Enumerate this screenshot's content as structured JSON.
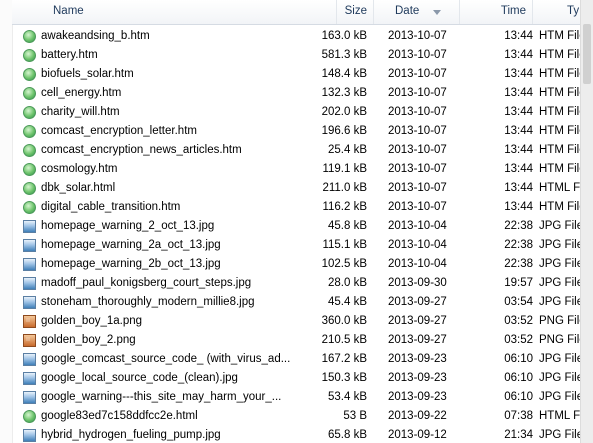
{
  "columns": {
    "name": "Name",
    "size": "Size",
    "date": "Date",
    "time": "Time",
    "type": "Ty"
  },
  "files": [
    {
      "name": "awakeandsing_b.htm",
      "size": "163.0 kB",
      "date": "2013-10-07",
      "time": "13:44",
      "type": "HTM File",
      "icon": "htm-file-icon"
    },
    {
      "name": "battery.htm",
      "size": "581.3 kB",
      "date": "2013-10-07",
      "time": "13:44",
      "type": "HTM File",
      "icon": "htm-file-icon"
    },
    {
      "name": "biofuels_solar.htm",
      "size": "148.4 kB",
      "date": "2013-10-07",
      "time": "13:44",
      "type": "HTM File",
      "icon": "htm-file-icon"
    },
    {
      "name": "cell_energy.htm",
      "size": "132.3 kB",
      "date": "2013-10-07",
      "time": "13:44",
      "type": "HTM File",
      "icon": "htm-file-icon"
    },
    {
      "name": "charity_will.htm",
      "size": "202.0 kB",
      "date": "2013-10-07",
      "time": "13:44",
      "type": "HTM File",
      "icon": "htm-file-icon"
    },
    {
      "name": "comcast_encryption_letter.htm",
      "size": "196.6 kB",
      "date": "2013-10-07",
      "time": "13:44",
      "type": "HTM File",
      "icon": "htm-file-icon"
    },
    {
      "name": "comcast_encryption_news_articles.htm",
      "size": "25.4 kB",
      "date": "2013-10-07",
      "time": "13:44",
      "type": "HTM File",
      "icon": "htm-file-icon"
    },
    {
      "name": "cosmology.htm",
      "size": "119.1 kB",
      "date": "2013-10-07",
      "time": "13:44",
      "type": "HTM File",
      "icon": "htm-file-icon"
    },
    {
      "name": "dbk_solar.html",
      "size": "211.0 kB",
      "date": "2013-10-07",
      "time": "13:44",
      "type": "HTML File",
      "icon": "htm-file-icon"
    },
    {
      "name": "digital_cable_transition.htm",
      "size": "116.2 kB",
      "date": "2013-10-07",
      "time": "13:44",
      "type": "HTM File",
      "icon": "htm-file-icon"
    },
    {
      "name": "homepage_warning_2_oct_13.jpg",
      "size": "45.8 kB",
      "date": "2013-10-04",
      "time": "22:38",
      "type": "JPG File",
      "icon": "jpg-image-icon"
    },
    {
      "name": "homepage_warning_2a_oct_13.jpg",
      "size": "115.1 kB",
      "date": "2013-10-04",
      "time": "22:38",
      "type": "JPG File",
      "icon": "jpg-image-icon"
    },
    {
      "name": "homepage_warning_2b_oct_13.jpg",
      "size": "102.5 kB",
      "date": "2013-10-04",
      "time": "22:38",
      "type": "JPG File",
      "icon": "jpg-image-icon"
    },
    {
      "name": "madoff_paul_konigsberg_court_steps.jpg",
      "size": "28.0 kB",
      "date": "2013-09-30",
      "time": "19:57",
      "type": "JPG File",
      "icon": "jpg-image-icon"
    },
    {
      "name": "stoneham_thoroughly_modern_millie8.jpg",
      "size": "45.4 kB",
      "date": "2013-09-27",
      "time": "03:54",
      "type": "JPG File",
      "icon": "jpg-image-icon"
    },
    {
      "name": "golden_boy_1a.png",
      "size": "360.0 kB",
      "date": "2013-09-27",
      "time": "03:52",
      "type": "PNG File",
      "icon": "png-image-icon"
    },
    {
      "name": "golden_boy_2.png",
      "size": "210.5 kB",
      "date": "2013-09-27",
      "time": "03:52",
      "type": "PNG File",
      "icon": "png-image-icon"
    },
    {
      "name": "google_comcast_source_code_ (with_virus_ad...",
      "size": "167.2 kB",
      "date": "2013-09-23",
      "time": "06:10",
      "type": "JPG File",
      "icon": "jpg-image-icon"
    },
    {
      "name": "google_local_source_code_(clean).jpg",
      "size": "150.3 kB",
      "date": "2013-09-23",
      "time": "06:10",
      "type": "JPG File",
      "icon": "jpg-image-icon"
    },
    {
      "name": "google_warning---this_site_may_harm_your_...",
      "size": "53.4 kB",
      "date": "2013-09-23",
      "time": "06:10",
      "type": "JPG File",
      "icon": "jpg-image-icon"
    },
    {
      "name": "google83ed7c158ddfcc2e.html",
      "size": "53 B",
      "date": "2013-09-22",
      "time": "07:38",
      "type": "HTML File",
      "icon": "htm-file-icon"
    },
    {
      "name": "hybrid_hydrogen_fueling_pump.jpg",
      "size": "65.8 kB",
      "date": "2013-09-12",
      "time": "21:34",
      "type": "JPG File",
      "icon": "jpg-image-icon"
    }
  ]
}
